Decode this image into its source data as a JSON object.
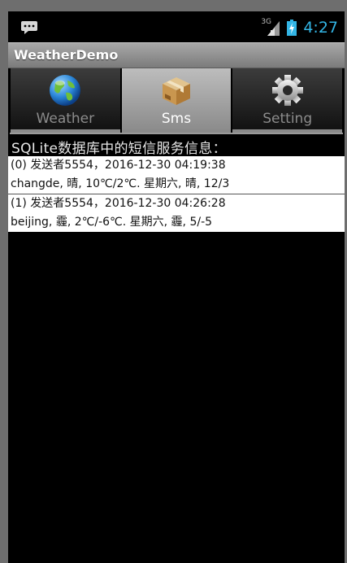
{
  "status_bar": {
    "network": "3G",
    "time": "4:27"
  },
  "app": {
    "title": "WeatherDemo"
  },
  "tabs": [
    {
      "label": "Weather",
      "icon": "globe-icon",
      "selected": false
    },
    {
      "label": "Sms",
      "icon": "box-icon",
      "selected": true
    },
    {
      "label": "Setting",
      "icon": "gear-icon",
      "selected": false
    }
  ],
  "content": {
    "heading": "SQLite数据库中的短信服务信息：",
    "messages": [
      {
        "header": "(0) 发送者5554，2016-12-30 04:19:38",
        "body": "changde, 晴, 10℃/2℃. 星期六, 晴, 12/3"
      },
      {
        "header": "(1) 发送者5554，2016-12-30 04:26:28",
        "body": "beijing, 霾, 2℃/-6℃. 星期六, 霾, 5/-5"
      }
    ]
  },
  "colors": {
    "clock": "#33b5e5",
    "background": "#000000",
    "message_bg": "#ffffff"
  }
}
